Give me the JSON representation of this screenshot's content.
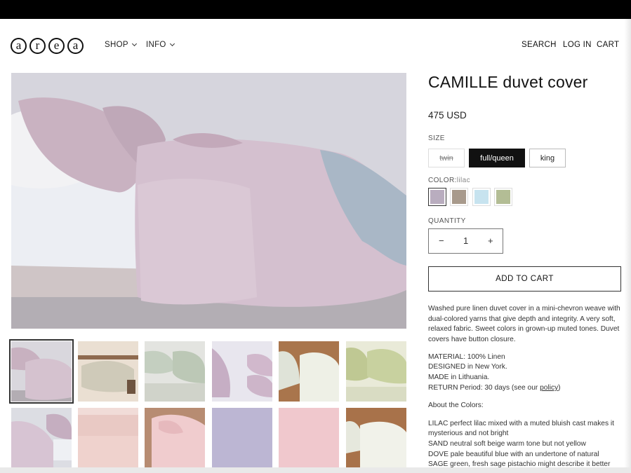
{
  "header": {
    "logo_letters": [
      "a",
      "r",
      "e",
      "a"
    ],
    "nav_left": [
      "SHOP",
      "INFO"
    ],
    "nav_right": [
      "SEARCH",
      "LOG IN",
      "CART"
    ]
  },
  "product": {
    "title": "CAMILLE duvet cover",
    "price": "475 USD",
    "size_label": "SIZE",
    "sizes": [
      {
        "label": "twin",
        "state": "unavailable"
      },
      {
        "label": "full/queen",
        "state": "selected"
      },
      {
        "label": "king",
        "state": "available"
      }
    ],
    "color_label": "COLOR:",
    "color_value": "lilac",
    "swatches": [
      {
        "name": "lilac",
        "color": "#b9adbf",
        "selected": true
      },
      {
        "name": "sand",
        "color": "#a89a8c",
        "selected": false
      },
      {
        "name": "dove",
        "color": "#c7e3ef",
        "selected": false
      },
      {
        "name": "sage",
        "color": "#b3bd95",
        "selected": false
      }
    ],
    "quantity_label": "QUANTITY",
    "quantity_value": "1",
    "minus": "−",
    "plus": "+",
    "add_to_cart": "ADD TO CART",
    "description": "Washed pure linen duvet cover in a mini-chevron weave with dual-colored yarns that give depth and integrity. A very soft, relaxed fabric. Sweet colors in grown-up muted tones. Duvet covers have button closure.",
    "material": "MATERIAL: 100% Linen",
    "designed": "DESIGNED in New York.",
    "made": "MADE in Lithuania.",
    "return_prefix": "RETURN Period: 30 days (see our",
    "return_link": "policy",
    "return_suffix": ")",
    "about_colors": "About the Colors:",
    "colors_text": [
      "LILAC perfect lilac mixed with a muted bluish cast makes it",
      "mysterious and not bright",
      "SAND neutral soft beige warm tone but not yellow",
      "DOVE pale beautiful blue with an undertone of natural",
      "SAGE green, fresh sage pistachio might describe it better"
    ]
  },
  "theme": {
    "accent": "#111111",
    "linen_lilac": "#d8c8d3"
  }
}
